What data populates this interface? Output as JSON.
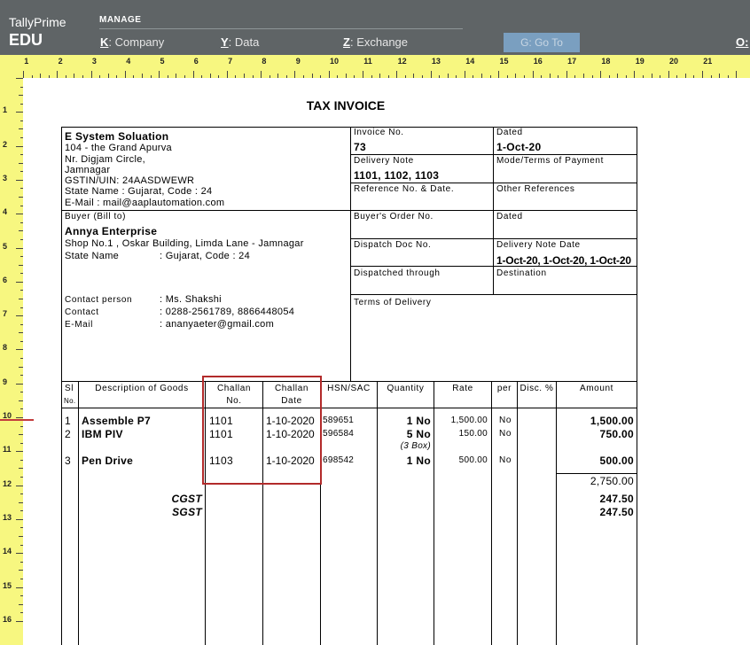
{
  "topbar": {
    "app_name": "TallyPrime",
    "edition": "EDU",
    "section": "MANAGE",
    "menu": [
      {
        "key": "K",
        "label": "Company"
      },
      {
        "key": "Y",
        "label": "Data"
      },
      {
        "key": "Z",
        "label": "Exchange"
      }
    ],
    "goto": "G: Go To",
    "extra_key": "O:"
  },
  "ruler": {
    "top_numbers": [
      "1",
      "2",
      "3",
      "4",
      "5",
      "6",
      "7",
      "8",
      "9",
      "10",
      "11",
      "12",
      "13",
      "14",
      "15",
      "16",
      "17",
      "18",
      "19",
      "20",
      "21"
    ],
    "left_numbers": [
      "1",
      "2",
      "3",
      "4",
      "5",
      "6",
      "7",
      "8",
      "9",
      "10",
      "11",
      "12",
      "13",
      "14",
      "15",
      "16"
    ]
  },
  "invoice": {
    "title": "TAX INVOICE",
    "seller": {
      "name": "E System Soluation",
      "address1": "104 - the Grand Apurva",
      "address2": "Nr. Digjam Circle,",
      "address3": "Jamnagar",
      "gstin": "GSTIN/UIN: 24AASDWEWR",
      "state": "State Name :  Gujarat, Code : 24",
      "email": "E-Mail : mail@aaplautomation.com"
    },
    "buyer": {
      "label": "Buyer (Bill to)",
      "name": "Annya Enterprise",
      "address": "Shop No.1 , Oskar Building, Limda Lane - Jamnagar",
      "state_label": "State Name",
      "state_value": ":  Gujarat, Code : 24",
      "contact_person_label": "Contact person",
      "contact_person": ":  Ms. Shakshi",
      "contact_label": "Contact",
      "contact": ":  0288-2561789, 8866448054",
      "email_label": "E-Mail",
      "email": ":  ananyaeter@gmail.com"
    },
    "meta": {
      "invoice_no_label": "Invoice No.",
      "invoice_no": "73",
      "dated_label": "Dated",
      "dated": "1-Oct-20",
      "delivery_note_label": "Delivery Note",
      "delivery_note": "1101, 1102, 1103",
      "mode_label": "Mode/Terms of Payment",
      "ref_label": "Reference No. & Date.",
      "other_ref_label": "Other References",
      "buyers_order_label": "Buyer's Order No.",
      "dated2_label": "Dated",
      "dispatch_doc_label": "Dispatch Doc No.",
      "dn_date_label": "Delivery Note Date",
      "dn_date": "1-Oct-20, 1-Oct-20, 1-Oct-20",
      "dispatched_through_label": "Dispatched through",
      "destination_label": "Destination",
      "terms_label": "Terms of Delivery"
    },
    "columns": {
      "sl": "Sl",
      "no": "No.",
      "description": "Description of Goods",
      "challan_no_1": "Challan",
      "challan_no_2": "No.",
      "challan_date_1": "Challan",
      "challan_date_2": "Date",
      "hsn": "HSN/SAC",
      "quantity": "Quantity",
      "rate": "Rate",
      "per": "per",
      "disc": "Disc. %",
      "amount": "Amount"
    },
    "rows": [
      {
        "sl": "1",
        "desc": "Assemble P7",
        "challan_no": "1101",
        "challan_date": "1-10-2020",
        "hsn": "589651",
        "qty": "1 No",
        "rate": "1,500.00",
        "per": "No",
        "amount": "1,500.00"
      },
      {
        "sl": "2",
        "desc": "IBM PIV",
        "challan_no": "1101",
        "challan_date": "1-10-2020",
        "hsn": "596584",
        "qty": "5 No",
        "qty_note": "(3 Box)",
        "rate": "150.00",
        "per": "No",
        "amount": "750.00"
      },
      {
        "sl": "3",
        "desc": "Pen Drive",
        "challan_no": "1103",
        "challan_date": "1-10-2020",
        "hsn": "698542",
        "qty": "1 No",
        "rate": "500.00",
        "per": "No",
        "amount": "500.00"
      }
    ],
    "subtotal": "2,750.00",
    "cgst_label": "CGST",
    "cgst": "247.50",
    "sgst_label": "SGST",
    "sgst": "247.50"
  },
  "colors": {
    "topbar": "#5f6466",
    "ruler": "#f7f780",
    "highlight": "#b22a2a"
  }
}
